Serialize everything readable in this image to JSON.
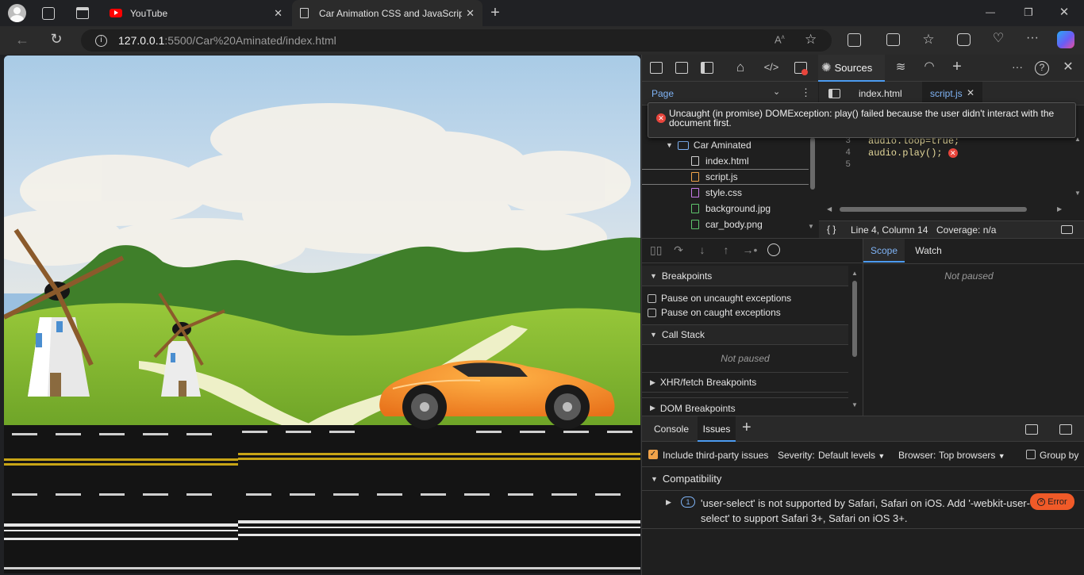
{
  "browser": {
    "tabs": [
      {
        "title": "YouTube",
        "close": "✕"
      },
      {
        "title": "Car Animation CSS and JavaScrip",
        "close": "✕"
      }
    ],
    "new_tab": "+",
    "address": {
      "host": "127.0.0.1",
      "path": ":5500/Car%20Aminated/index.html"
    },
    "window_controls": {
      "minimize": "—",
      "maximize": "❐",
      "close": "✕"
    }
  },
  "devtools": {
    "toolbar": {
      "sources_label": "Sources",
      "more": "···",
      "help": "?",
      "close": "✕",
      "add": "+"
    },
    "navigator": {
      "tab_label": "Page"
    },
    "editor_tabs": [
      {
        "label": "index.html"
      },
      {
        "label": "script.js",
        "close": "✕"
      }
    ],
    "error_popup": "Uncaught (in promise) DOMException: play() failed because the user didn't interact with the document first.",
    "file_tree": {
      "folder": "Car Aminated",
      "files": [
        "index.html",
        "script.js",
        "style.css",
        "background.jpg",
        "car_body.png"
      ]
    },
    "code_lines": [
      {
        "num": "3",
        "text": "audio.loop=true;"
      },
      {
        "num": "4",
        "text": "audio.play();"
      },
      {
        "num": "5",
        "text": ""
      }
    ],
    "status_bar": {
      "braces": "{ }",
      "position": "Line 4, Column 14",
      "coverage": "Coverage: n/a"
    },
    "debugger": {
      "breakpoints_title": "Breakpoints",
      "pause_uncaught": "Pause on uncaught exceptions",
      "pause_caught": "Pause on caught exceptions",
      "call_stack_title": "Call Stack",
      "call_stack_empty": "Not paused",
      "xhr_title": "XHR/fetch Breakpoints",
      "dom_title": "DOM Breakpoints"
    },
    "scope": {
      "tab_scope": "Scope",
      "tab_watch": "Watch",
      "empty": "Not paused"
    },
    "drawer": {
      "tab_console": "Console",
      "tab_issues": "Issues",
      "add": "+",
      "include_third_party": "Include third-party issues",
      "severity_label": "Severity:",
      "severity_value": "Default levels",
      "browser_label": "Browser:",
      "browser_value": "Top browsers",
      "group_by": "Group by",
      "category": "Compatibility",
      "issue_count": "1",
      "issue_text": "'user-select' is not supported by Safari, Safari on iOS. Add '-webkit-user-select' to support Safari 3+, Safari on iOS 3+.",
      "issue_badge": "Error"
    }
  },
  "colors": {
    "accent": "#4c9bf0",
    "error": "#e8453c",
    "warning_badge": "#f05a28"
  }
}
